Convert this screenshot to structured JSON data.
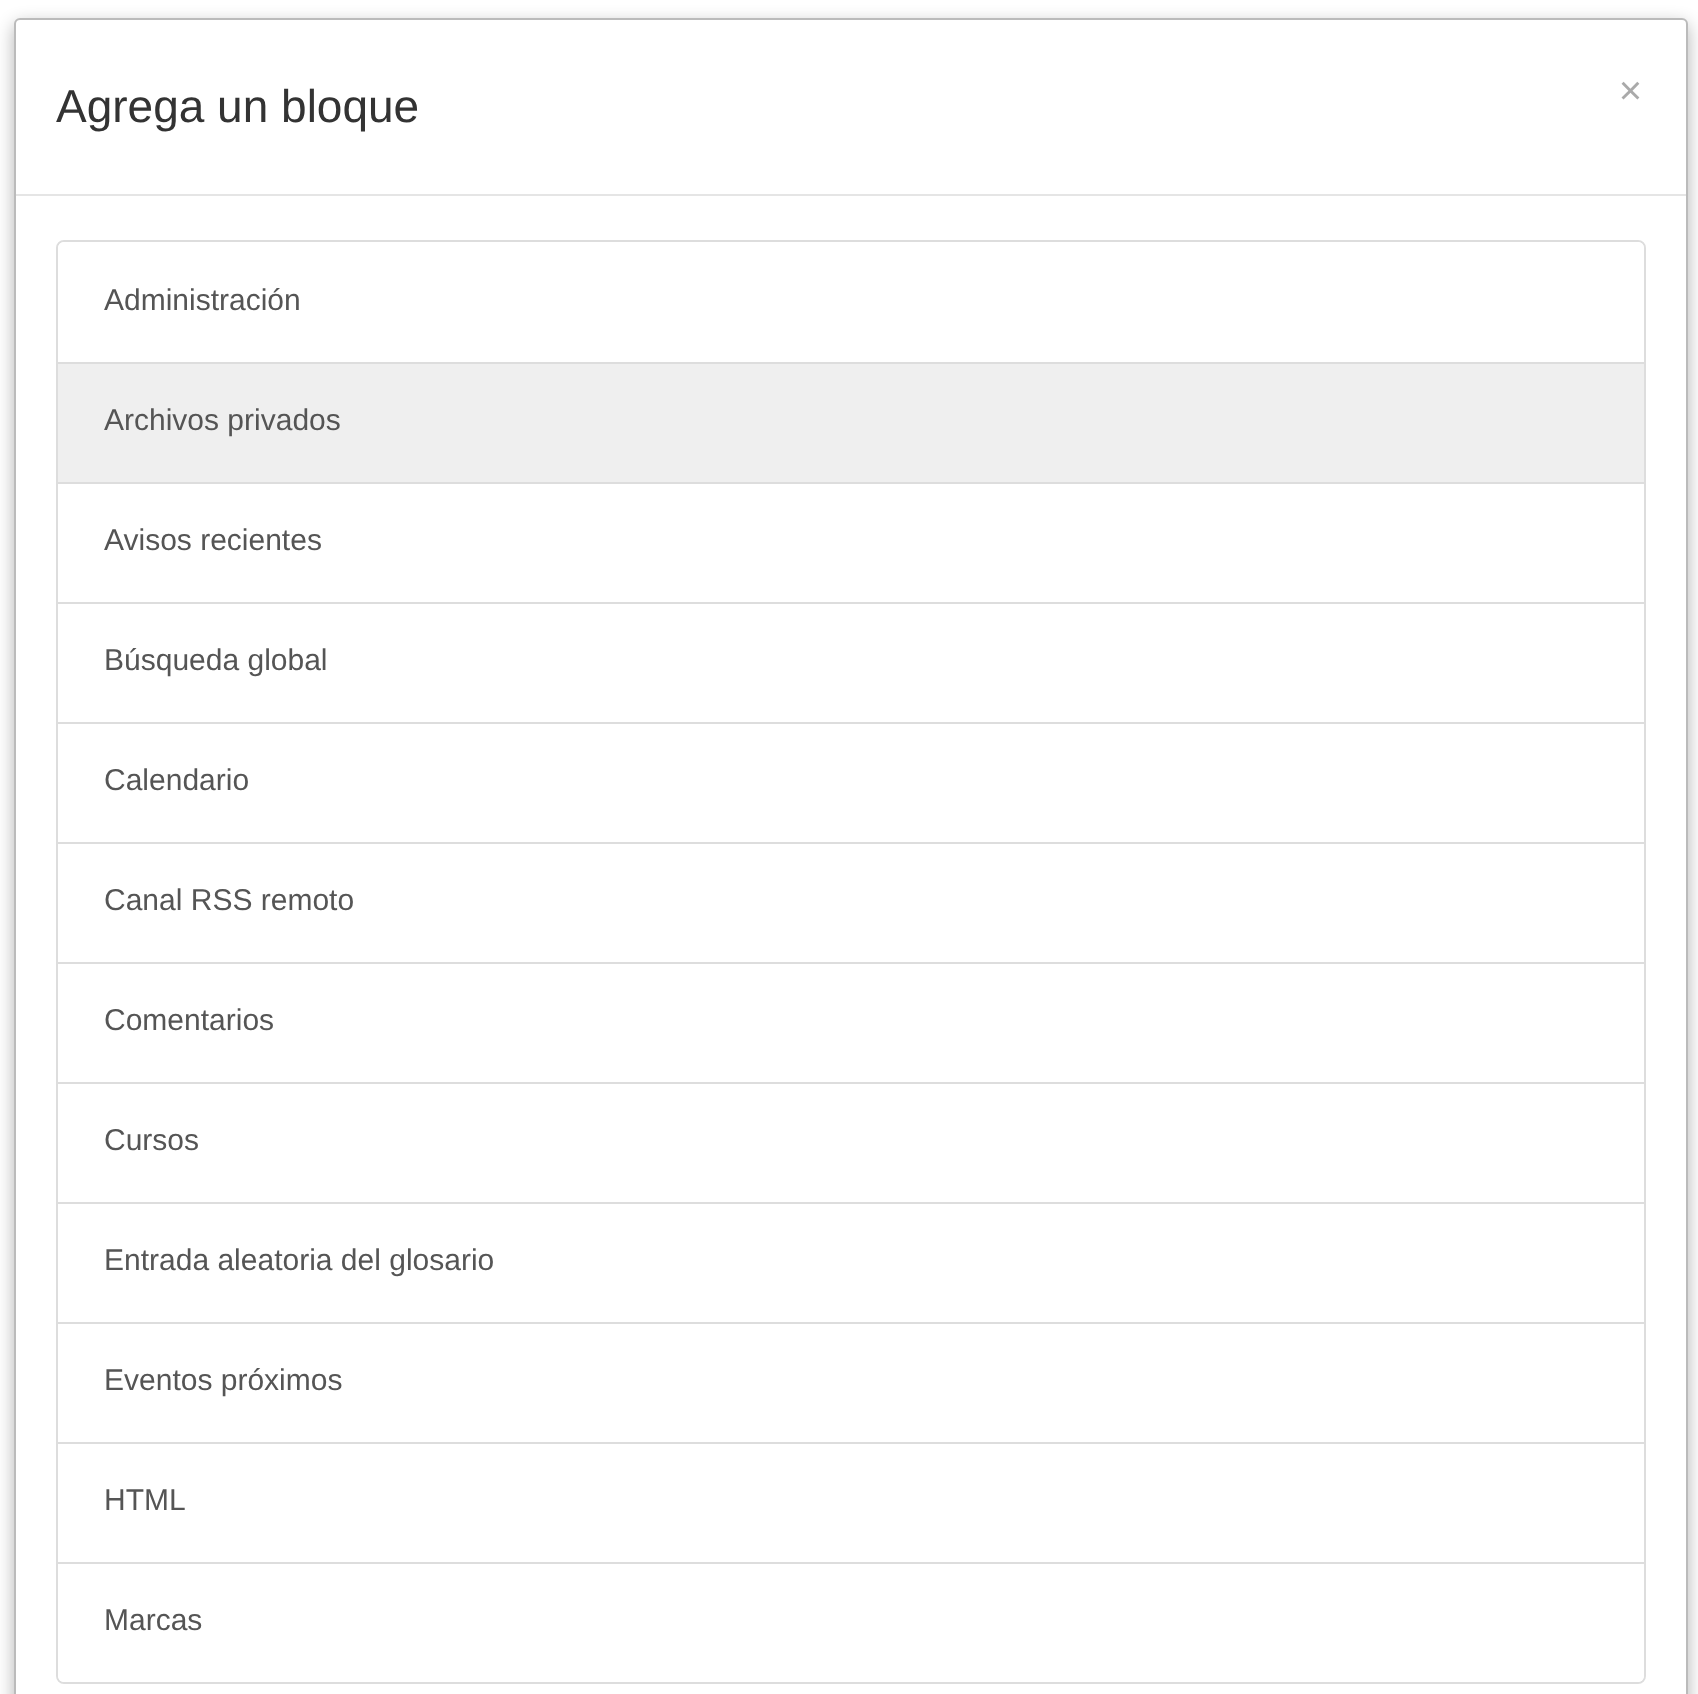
{
  "dialog": {
    "title": "Agrega un bloque",
    "close": "×"
  },
  "items": [
    {
      "label": "Administración",
      "selected": false
    },
    {
      "label": "Archivos privados",
      "selected": true
    },
    {
      "label": "Avisos recientes",
      "selected": false
    },
    {
      "label": "Búsqueda global",
      "selected": false
    },
    {
      "label": "Calendario",
      "selected": false
    },
    {
      "label": "Canal RSS remoto",
      "selected": false
    },
    {
      "label": "Comentarios",
      "selected": false
    },
    {
      "label": "Cursos",
      "selected": false
    },
    {
      "label": "Entrada aleatoria del glosario",
      "selected": false
    },
    {
      "label": "Eventos próximos",
      "selected": false
    },
    {
      "label": "HTML",
      "selected": false
    },
    {
      "label": "Marcas",
      "selected": false
    }
  ]
}
